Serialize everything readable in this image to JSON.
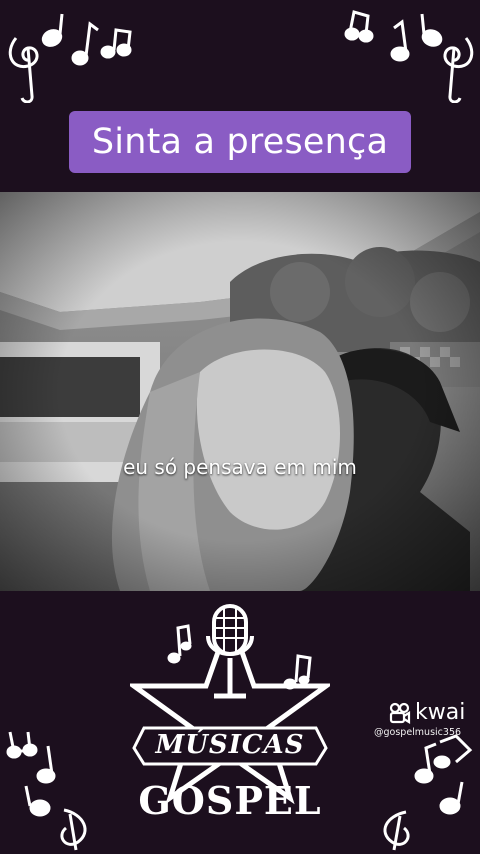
{
  "header": {
    "title": "Sinta a presença"
  },
  "video": {
    "caption": "eu só pensava em mim"
  },
  "logo": {
    "line1": "MÚSICAS",
    "line2": "GOSPEL",
    "icon": "microphone-icon"
  },
  "watermark": {
    "brand": "kwai",
    "handle": "@gospelmusic356"
  },
  "colors": {
    "background": "#1c0f1e",
    "badge": "#8a5cc4",
    "text": "#ffffff"
  }
}
